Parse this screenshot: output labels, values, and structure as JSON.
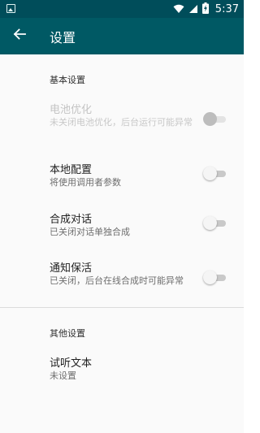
{
  "status_bar": {
    "time": "5:37",
    "icons": [
      "image-notification-icon",
      "wifi-icon",
      "signal-icon",
      "battery-charging-icon"
    ]
  },
  "toolbar": {
    "title": "设置",
    "back_icon": "arrow-back-icon"
  },
  "sections": {
    "basic": {
      "header": "基本设置",
      "items": [
        {
          "title": "电池优化",
          "summary": "未关闭电池优化，后台运行可能异常",
          "enabled": false,
          "checked": false
        },
        {
          "title": "本地配置",
          "summary": "将使用调用者参数",
          "enabled": true,
          "checked": false
        },
        {
          "title": "合成对话",
          "summary": "已关闭对话单独合成",
          "enabled": true,
          "checked": false
        },
        {
          "title": "通知保活",
          "summary": "已关闭，后台在线合成时可能异常",
          "enabled": true,
          "checked": false
        }
      ]
    },
    "other": {
      "header": "其他设置",
      "items": [
        {
          "title": "试听文本",
          "summary": "未设置"
        }
      ]
    }
  },
  "colors": {
    "status_bar": "#004d5a",
    "toolbar": "#005964",
    "background": "#fafafa"
  }
}
